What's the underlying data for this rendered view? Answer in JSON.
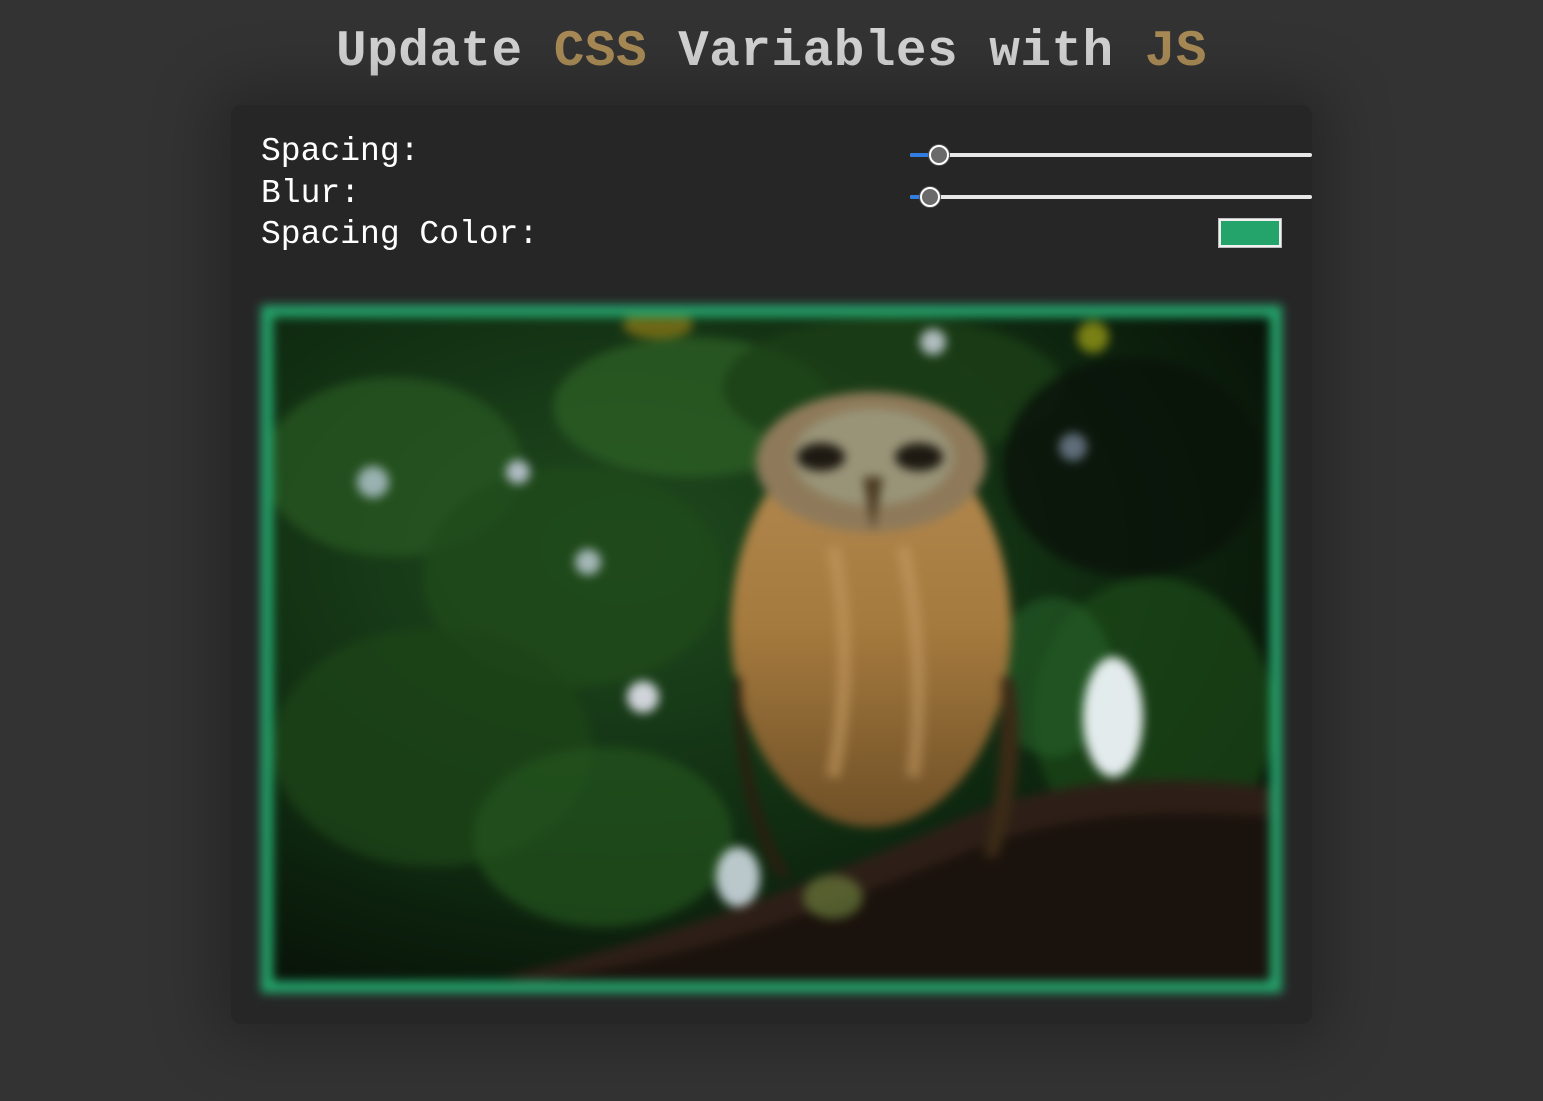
{
  "header": {
    "title_part1": "Update ",
    "title_css": "CSS",
    "title_part2": " Variables with ",
    "title_js": "JS"
  },
  "controls": {
    "spacing": {
      "label": "Spacing:",
      "value": 10,
      "min": 0,
      "max": 200
    },
    "blur": {
      "label": "Blur:",
      "value": 10,
      "min": 0,
      "max": 400
    },
    "spacing_color": {
      "label": "Spacing Color:",
      "value": "#24a36b"
    }
  },
  "colors": {
    "background": "#333333",
    "panel": "#262626",
    "accent": "#a88a55",
    "slider_fill": "#2f7de1"
  },
  "image": {
    "subject": "owl-on-branch-photo"
  }
}
